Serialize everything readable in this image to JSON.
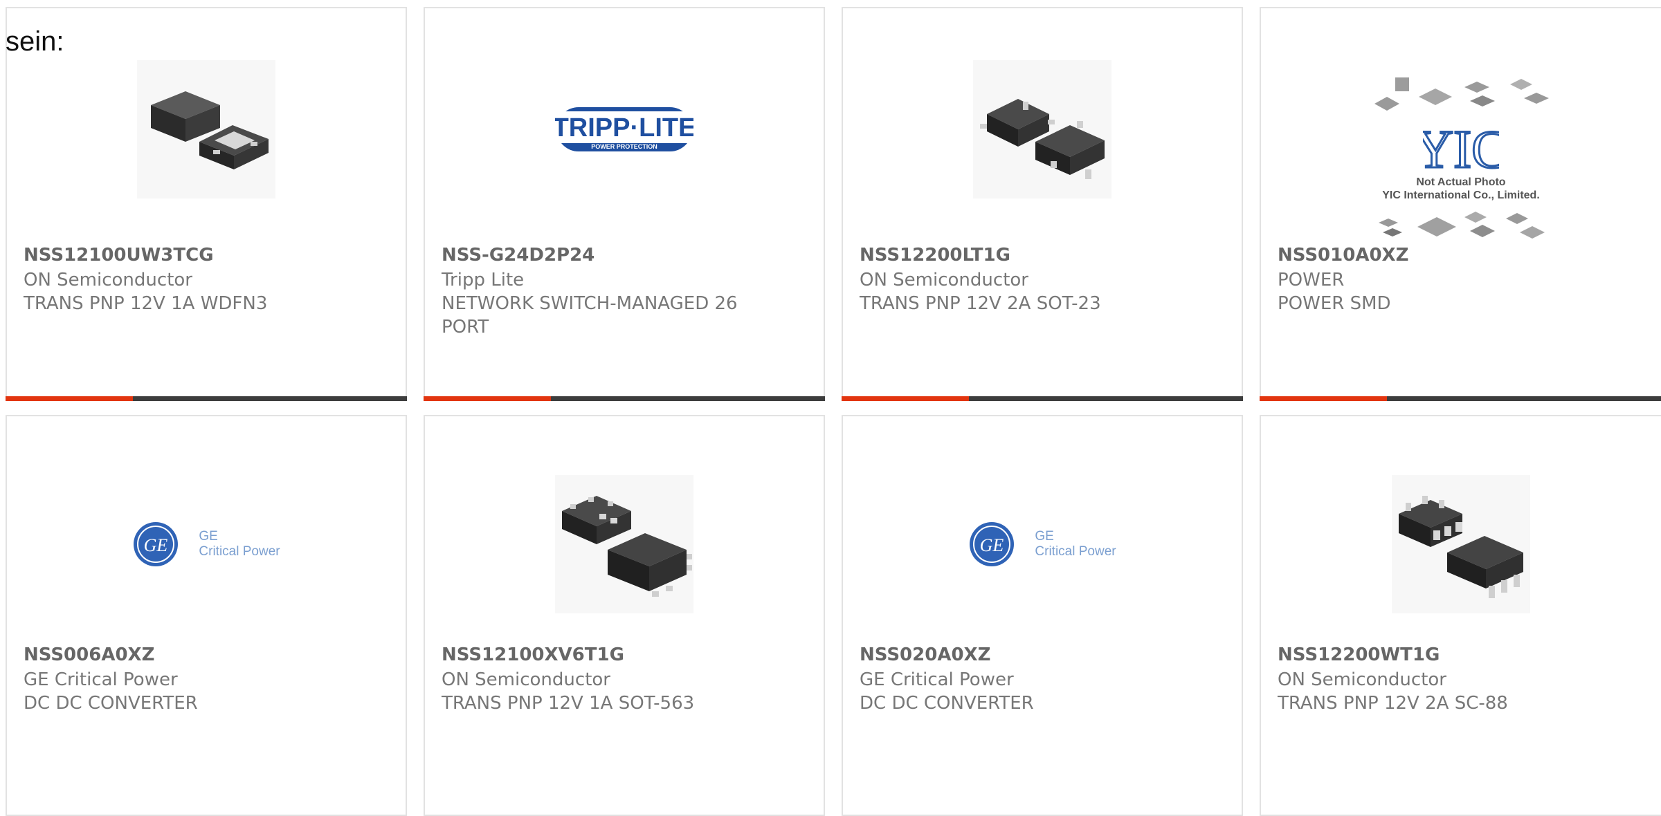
{
  "page": {
    "intro_text": "sein:"
  },
  "accent_color": "#e2350f",
  "bar_color": "#3d3d3d",
  "products": [
    {
      "part_number": "NSS12100UW3TCG",
      "manufacturer": "ON Semiconductor",
      "description": "TRANS PNP 12V 1A WDFN3",
      "image": "wdfn3-package-image"
    },
    {
      "part_number": "NSS-G24D2P24",
      "manufacturer": "Tripp Lite",
      "description": "NETWORK SWITCH-MANAGED 26 PORT",
      "image": "tripp-lite-logo",
      "logo": {
        "brand": "TRIPP·LITE",
        "tagline": "POWER PROTECTION"
      }
    },
    {
      "part_number": "NSS12200LT1G",
      "manufacturer": "ON Semiconductor",
      "description": "TRANS PNP 12V 2A SOT-23",
      "image": "sot23-package-image"
    },
    {
      "part_number": "NSS010A0XZ",
      "manufacturer": "POWER",
      "description": "POWER SMD",
      "image": "yic-placeholder-image",
      "placeholder": {
        "logo": "YIC",
        "caption_1": "Not Actual Photo",
        "caption_2": "YIC International Co., Limited."
      }
    },
    {
      "part_number": "NSS006A0XZ",
      "manufacturer": "GE Critical Power",
      "description": "DC DC CONVERTER",
      "image": "ge-critical-power-logo",
      "logo": {
        "line_1": "GE",
        "line_2": "Critical Power"
      }
    },
    {
      "part_number": "NSS12100XV6T1G",
      "manufacturer": "ON Semiconductor",
      "description": "TRANS PNP 12V 1A SOT-563",
      "image": "sot563-package-image"
    },
    {
      "part_number": "NSS020A0XZ",
      "manufacturer": "GE Critical Power",
      "description": "DC DC CONVERTER",
      "image": "ge-critical-power-logo",
      "logo": {
        "line_1": "GE",
        "line_2": "Critical Power"
      }
    },
    {
      "part_number": "NSS12200WT1G",
      "manufacturer": "ON Semiconductor",
      "description": "TRANS PNP 12V 2A SC-88",
      "image": "sc88-package-image"
    }
  ]
}
